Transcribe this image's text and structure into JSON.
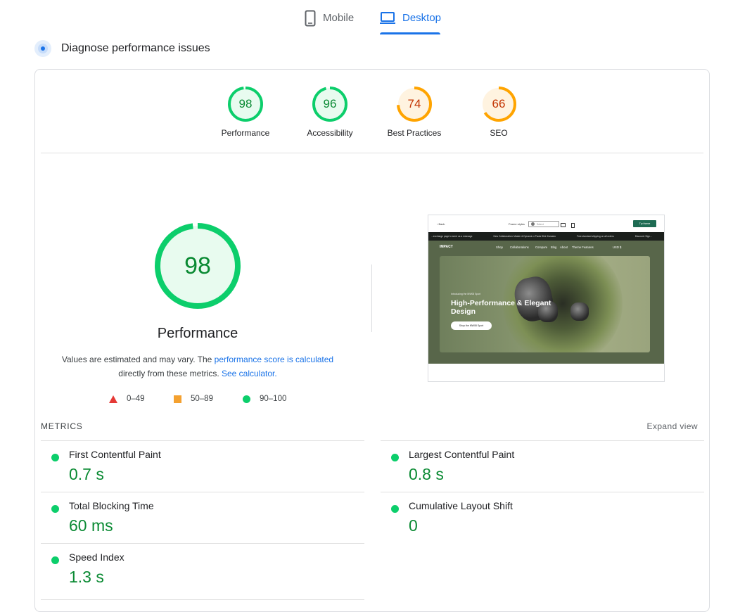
{
  "tabs": {
    "mobile": "Mobile",
    "desktop": "Desktop",
    "active": "desktop"
  },
  "diagnose": {
    "title": "Diagnose performance issues"
  },
  "categories": [
    {
      "label": "Performance",
      "score": "98",
      "rating": "pass",
      "fraction": 0.98
    },
    {
      "label": "Accessibility",
      "score": "96",
      "rating": "pass",
      "fraction": 0.96
    },
    {
      "label": "Best Practices",
      "score": "74",
      "rating": "average",
      "fraction": 0.74
    },
    {
      "label": "SEO",
      "score": "66",
      "rating": "average",
      "fraction": 0.66
    }
  ],
  "performance": {
    "score": "98",
    "fraction": 0.98,
    "title": "Performance",
    "desc_1": "Values are estimated and may vary. The ",
    "desc_link_1": "performance score is calculated",
    "desc_2": "directly from these metrics. ",
    "desc_link_2": "See calculator."
  },
  "legend": {
    "fail": "0–49",
    "average": "50–89",
    "pass": "90–100"
  },
  "screenshot": {
    "back": "‹  Back",
    "frame_label": "Frame styles",
    "select": "Select",
    "cta": "Try theme",
    "announcements": [
      "...exchange page to send us a message",
      "New Collaboration: Master & Dynamic x Paola Sfeir Kamado",
      "Free standard shipping on all orders",
      "Discount: Sign..."
    ],
    "logo": "IMPACT",
    "nav": [
      "Shop",
      "Collaborations",
      "Compare",
      "Blog",
      "About",
      "Theme Features"
    ],
    "currency": "USD $",
    "eyebrow": "Introducing the MW08 Sport",
    "headline_1": "High-Performance & Elegant",
    "headline_2": "Design",
    "button": "Shop the MW08 Sport"
  },
  "metrics": {
    "title": "METRICS",
    "expand": "Expand view",
    "items": [
      {
        "name": "First Contentful Paint",
        "value": "0.7 s"
      },
      {
        "name": "Largest Contentful Paint",
        "value": "0.8 s"
      },
      {
        "name": "Total Blocking Time",
        "value": "60 ms"
      },
      {
        "name": "Cumulative Layout Shift",
        "value": "0"
      },
      {
        "name": "Speed Index",
        "value": "1.3 s"
      }
    ]
  },
  "colors": {
    "pass": "#0cce6b",
    "pass_text": "#0a8a33",
    "pass_bg": "#e8fbef",
    "average": "#ffa400",
    "average_text": "#c33300",
    "average_bg": "#fff3e0",
    "fail": "#e53935",
    "accent": "#1a73e8"
  }
}
